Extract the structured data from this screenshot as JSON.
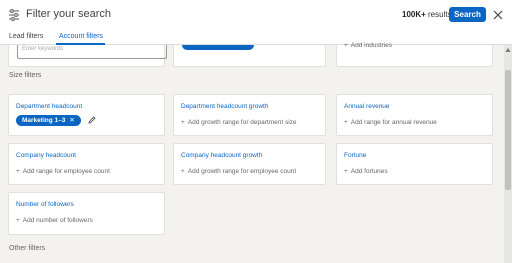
{
  "header": {
    "title": "Filter your search",
    "results_count": "100K+",
    "results_suffix": " results",
    "search_label": "Search"
  },
  "tabs": [
    {
      "label": "Lead filters",
      "active": false
    },
    {
      "label": "Account filters",
      "active": true
    }
  ],
  "top_row": {
    "input_placeholder": "Enter keywords",
    "industries_add": "Add industries"
  },
  "sections": {
    "size": "Size filters",
    "other": "Other filters"
  },
  "cards": {
    "department_headcount": {
      "title": "Department headcount",
      "chip": "Marketing 1–3",
      "chip_remove": "✕"
    },
    "department_growth": {
      "title": "Department headcount growth",
      "add": "Add growth range for department size"
    },
    "annual_revenue": {
      "title": "Annual revenue",
      "add": "Add range for annual revenue"
    },
    "company_headcount": {
      "title": "Company headcount",
      "add": "Add range for employee count"
    },
    "company_growth": {
      "title": "Company headcount growth",
      "add": "Add growth range for employee count"
    },
    "fortune": {
      "title": "Fortune",
      "add": "Add fortunes"
    },
    "followers": {
      "title": "Number of followers",
      "add": "Add number of followers"
    }
  },
  "icons": {
    "filter": "filter-icon",
    "close": "close-icon",
    "edit": "pencil-icon",
    "plus": "plus-icon"
  },
  "colors": {
    "accent": "#0a66c2",
    "background": "#f3f2ef"
  }
}
